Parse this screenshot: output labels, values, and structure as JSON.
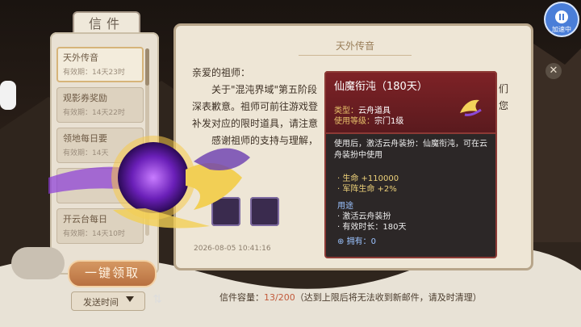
{
  "speed_button": {
    "label": "加速中"
  },
  "mail_panel": {
    "title": "信件",
    "items": [
      {
        "title": "天外传音",
        "expiry": "有效期：14天23时"
      },
      {
        "title": "观影券奖励",
        "expiry": "有效期：14天22时"
      },
      {
        "title": "领地每日要",
        "expiry": "有效期：14天"
      },
      {
        "title": "",
        "expiry": ""
      },
      {
        "title": "开云台每日",
        "expiry": "有效期：14天10时"
      }
    ],
    "claim_all_label": "一键领取",
    "sort_label": "发送时间",
    "sort_toggle_icon": "swap-icon"
  },
  "letter": {
    "header": "天外传音",
    "greeting": "亲爱的祖师：",
    "lines": [
      "关于\"混沌界域\"第五阶段",
      "深表歉意。祖师可前往游戏登",
      "补发对应的限时道具，请注意",
      "感谢祖师的支持与理解，"
    ],
    "right_fragments": [
      "们",
      "您"
    ],
    "date": "2026-08-05 10:41:16"
  },
  "capacity": {
    "label": "信件容量：",
    "value": "13/200",
    "note": "（达到上限后将无法收到新邮件，请及时清理）"
  },
  "tooltip": {
    "title": "仙魔衔沌（180天）",
    "type_key": "类型：",
    "type_value": "云舟道具",
    "level_key": "使用等级：",
    "level_value": "宗门1级",
    "description": "使用后，激活云舟装扮：仙魔衔沌，可在云舟装扮中使用",
    "stats": [
      "· 生命 +110000",
      "· 军阵生命 +2%"
    ],
    "use_header": "用途",
    "use_items": [
      "· 激活云舟装扮",
      "· 有效时长：180天"
    ],
    "own_label": "拥有：",
    "own_value": "0"
  },
  "colors": {
    "accent": "#4a7ed8",
    "tooltip_header": "#7e2226",
    "stat_gold": "#eed27a",
    "use_blue": "#9bc3ff",
    "claim_btn": "#c8814f"
  }
}
